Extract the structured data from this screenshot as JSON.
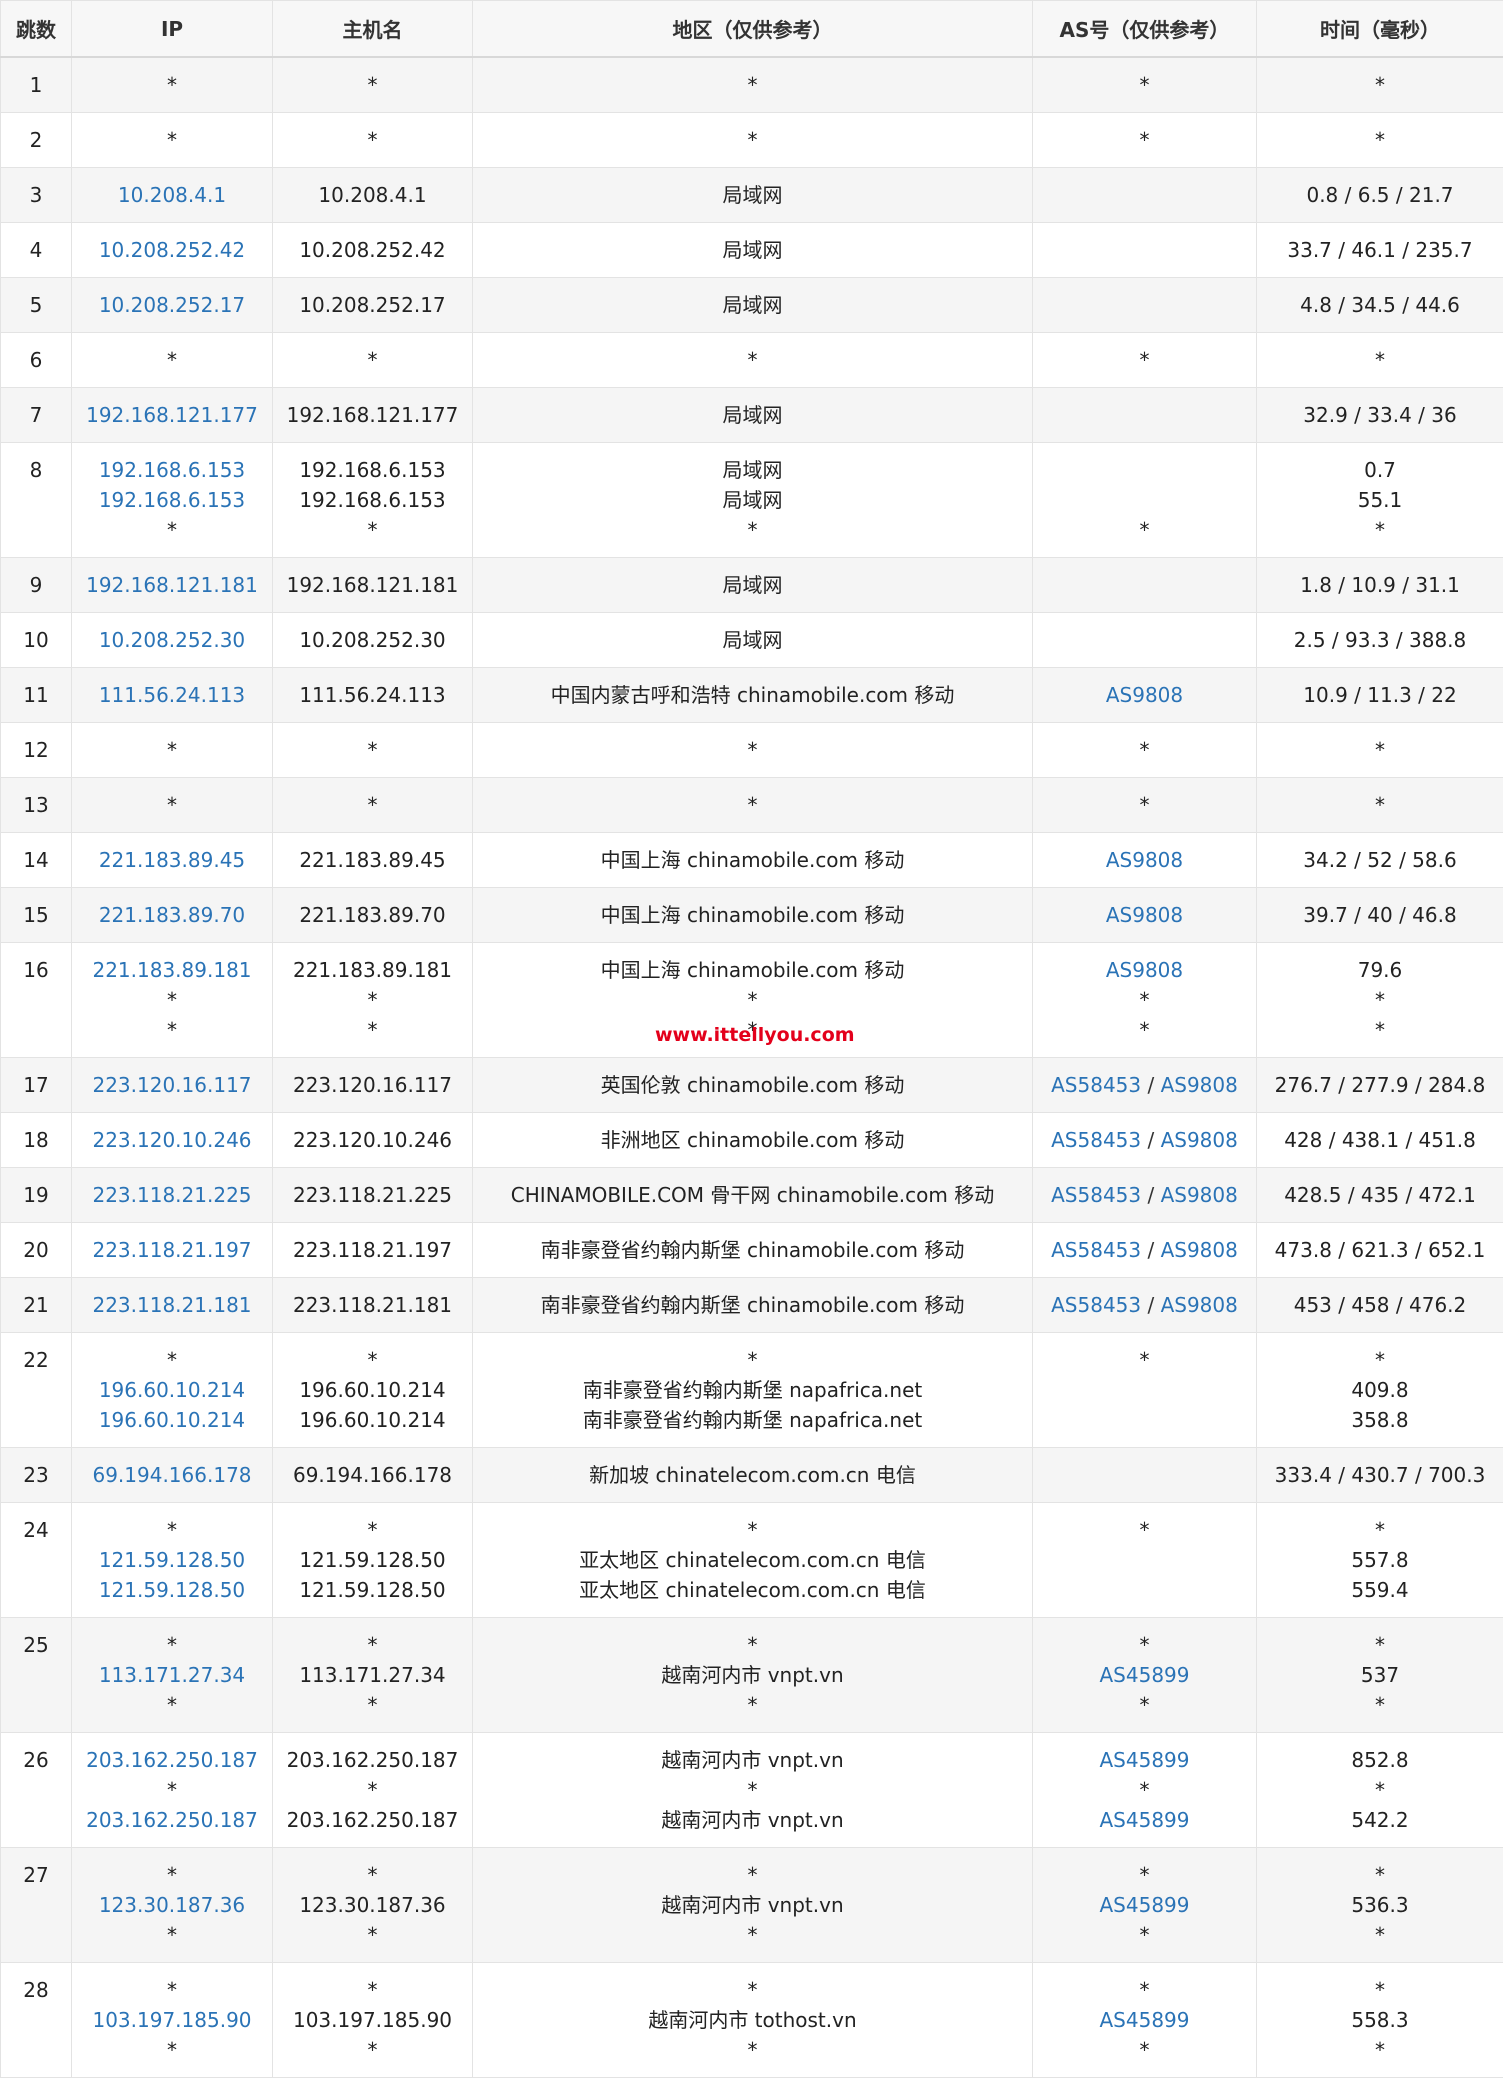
{
  "headers": {
    "hop": "跳数",
    "ip": "IP",
    "host": "主机名",
    "location": "地区（仅供参考）",
    "as": "AS号（仅供参考）",
    "time": "时间（毫秒）"
  },
  "rows": [
    {
      "hop": "1",
      "h": 55,
      "ip": [
        "*"
      ],
      "host": [
        "*"
      ],
      "loc": [
        "*"
      ],
      "as": [
        [
          "*"
        ]
      ],
      "time": [
        "*"
      ]
    },
    {
      "hop": "2",
      "h": 55,
      "ip": [
        "*"
      ],
      "host": [
        "*"
      ],
      "loc": [
        "*"
      ],
      "as": [
        [
          "*"
        ]
      ],
      "time": [
        "*"
      ]
    },
    {
      "hop": "3",
      "h": 55,
      "ip": [
        "10.208.4.1"
      ],
      "host": [
        "10.208.4.1"
      ],
      "loc": [
        "局域网"
      ],
      "as": [],
      "time": [
        "0.8 / 6.5 / 21.7"
      ]
    },
    {
      "hop": "4",
      "h": 55,
      "ip": [
        "10.208.252.42"
      ],
      "host": [
        "10.208.252.42"
      ],
      "loc": [
        "局域网"
      ],
      "as": [],
      "time": [
        "33.7 / 46.1 / 235.7"
      ]
    },
    {
      "hop": "5",
      "h": 55,
      "ip": [
        "10.208.252.17"
      ],
      "host": [
        "10.208.252.17"
      ],
      "loc": [
        "局域网"
      ],
      "as": [],
      "time": [
        "4.8 / 34.5 / 44.6"
      ]
    },
    {
      "hop": "6",
      "h": 55,
      "ip": [
        "*"
      ],
      "host": [
        "*"
      ],
      "loc": [
        "*"
      ],
      "as": [
        [
          "*"
        ]
      ],
      "time": [
        "*"
      ]
    },
    {
      "hop": "7",
      "h": 55,
      "ip": [
        "192.168.121.177"
      ],
      "host": [
        "192.168.121.177"
      ],
      "loc": [
        "局域网"
      ],
      "as": [],
      "time": [
        "32.9 / 33.4 / 36"
      ]
    },
    {
      "hop": "8",
      "h": 115,
      "ip": [
        "192.168.6.153",
        "192.168.6.153",
        "*"
      ],
      "host": [
        "192.168.6.153",
        "192.168.6.153",
        "*"
      ],
      "loc": [
        "局域网",
        "局域网",
        "*"
      ],
      "as": [
        [
          ""
        ],
        [
          ""
        ],
        [
          "*"
        ]
      ],
      "time": [
        "0.7",
        "55.1",
        "*"
      ]
    },
    {
      "hop": "9",
      "h": 55,
      "ip": [
        "192.168.121.181"
      ],
      "host": [
        "192.168.121.181"
      ],
      "loc": [
        "局域网"
      ],
      "as": [],
      "time": [
        "1.8 / 10.9 / 31.1"
      ]
    },
    {
      "hop": "10",
      "h": 55,
      "ip": [
        "10.208.252.30"
      ],
      "host": [
        "10.208.252.30"
      ],
      "loc": [
        "局域网"
      ],
      "as": [],
      "time": [
        "2.5 / 93.3 / 388.8"
      ]
    },
    {
      "hop": "11",
      "h": 55,
      "ip": [
        "111.56.24.113"
      ],
      "host": [
        "111.56.24.113"
      ],
      "loc": [
        "中国内蒙古呼和浩特 chinamobile.com 移动"
      ],
      "as": [
        [
          "AS9808"
        ]
      ],
      "time": [
        "10.9 / 11.3 / 22"
      ]
    },
    {
      "hop": "12",
      "h": 55,
      "ip": [
        "*"
      ],
      "host": [
        "*"
      ],
      "loc": [
        "*"
      ],
      "as": [
        [
          "*"
        ]
      ],
      "time": [
        "*"
      ]
    },
    {
      "hop": "13",
      "h": 55,
      "ip": [
        "*"
      ],
      "host": [
        "*"
      ],
      "loc": [
        "*"
      ],
      "as": [
        [
          "*"
        ]
      ],
      "time": [
        "*"
      ]
    },
    {
      "hop": "14",
      "h": 55,
      "ip": [
        "221.183.89.45"
      ],
      "host": [
        "221.183.89.45"
      ],
      "loc": [
        "中国上海 chinamobile.com 移动"
      ],
      "as": [
        [
          "AS9808"
        ]
      ],
      "time": [
        "34.2 / 52 / 58.6"
      ]
    },
    {
      "hop": "15",
      "h": 55,
      "ip": [
        "221.183.89.70"
      ],
      "host": [
        "221.183.89.70"
      ],
      "loc": [
        "中国上海 chinamobile.com 移动"
      ],
      "as": [
        [
          "AS9808"
        ]
      ],
      "time": [
        "39.7 / 40 / 46.8"
      ]
    },
    {
      "hop": "16",
      "h": 115,
      "ip": [
        "221.183.89.181",
        "*",
        "*"
      ],
      "host": [
        "221.183.89.181",
        "*",
        "*"
      ],
      "loc": [
        "中国上海 chinamobile.com 移动",
        "*",
        "*"
      ],
      "as": [
        [
          "AS9808"
        ],
        [
          "*"
        ],
        [
          "*"
        ]
      ],
      "time": [
        "79.6",
        "*",
        "*"
      ]
    },
    {
      "hop": "17",
      "h": 55,
      "ip": [
        "223.120.16.117"
      ],
      "host": [
        "223.120.16.117"
      ],
      "loc": [
        "英国伦敦 chinamobile.com 移动"
      ],
      "as": [
        [
          "AS58453",
          "AS9808"
        ]
      ],
      "time": [
        "276.7 / 277.9 / 284.8"
      ]
    },
    {
      "hop": "18",
      "h": 55,
      "ip": [
        "223.120.10.246"
      ],
      "host": [
        "223.120.10.246"
      ],
      "loc": [
        "非洲地区 chinamobile.com 移动"
      ],
      "as": [
        [
          "AS58453",
          "AS9808"
        ]
      ],
      "time": [
        "428 / 438.1 / 451.8"
      ]
    },
    {
      "hop": "19",
      "h": 55,
      "ip": [
        "223.118.21.225"
      ],
      "host": [
        "223.118.21.225"
      ],
      "loc": [
        "CHINAMOBILE.COM 骨干网 chinamobile.com 移动"
      ],
      "as": [
        [
          "AS58453",
          "AS9808"
        ]
      ],
      "time": [
        "428.5 / 435 / 472.1"
      ]
    },
    {
      "hop": "20",
      "h": 55,
      "ip": [
        "223.118.21.197"
      ],
      "host": [
        "223.118.21.197"
      ],
      "loc": [
        "南非豪登省约翰内斯堡 chinamobile.com 移动"
      ],
      "as": [
        [
          "AS58453",
          "AS9808"
        ]
      ],
      "time": [
        "473.8 / 621.3 / 652.1"
      ]
    },
    {
      "hop": "21",
      "h": 55,
      "ip": [
        "223.118.21.181"
      ],
      "host": [
        "223.118.21.181"
      ],
      "loc": [
        "南非豪登省约翰内斯堡 chinamobile.com 移动"
      ],
      "as": [
        [
          "AS58453",
          "AS9808"
        ]
      ],
      "time": [
        "453 / 458 / 476.2"
      ]
    },
    {
      "hop": "22",
      "h": 115,
      "ip": [
        "*",
        "196.60.10.214",
        "196.60.10.214"
      ],
      "host": [
        "*",
        "196.60.10.214",
        "196.60.10.214"
      ],
      "loc": [
        "*",
        "南非豪登省约翰内斯堡 napafrica.net",
        "南非豪登省约翰内斯堡 napafrica.net"
      ],
      "as": [
        [
          "*"
        ]
      ],
      "time": [
        "*",
        "409.8",
        "358.8"
      ]
    },
    {
      "hop": "23",
      "h": 55,
      "ip": [
        "69.194.166.178"
      ],
      "host": [
        "69.194.166.178"
      ],
      "loc": [
        "新加坡 chinatelecom.com.cn 电信"
      ],
      "as": [],
      "time": [
        "333.4 / 430.7 / 700.3"
      ]
    },
    {
      "hop": "24",
      "h": 115,
      "ip": [
        "*",
        "121.59.128.50",
        "121.59.128.50"
      ],
      "host": [
        "*",
        "121.59.128.50",
        "121.59.128.50"
      ],
      "loc": [
        "*",
        "亚太地区 chinatelecom.com.cn 电信",
        "亚太地区 chinatelecom.com.cn 电信"
      ],
      "as": [
        [
          "*"
        ]
      ],
      "time": [
        "*",
        "557.8",
        "559.4"
      ]
    },
    {
      "hop": "25",
      "h": 115,
      "ip": [
        "*",
        "113.171.27.34",
        "*"
      ],
      "host": [
        "*",
        "113.171.27.34",
        "*"
      ],
      "loc": [
        "*",
        "越南河内市 vnpt.vn",
        "*"
      ],
      "as": [
        [
          "*"
        ],
        [
          "AS45899"
        ],
        [
          "*"
        ]
      ],
      "time": [
        "*",
        "537",
        "*"
      ]
    },
    {
      "hop": "26",
      "h": 115,
      "ip": [
        "203.162.250.187",
        "*",
        "203.162.250.187"
      ],
      "host": [
        "203.162.250.187",
        "*",
        "203.162.250.187"
      ],
      "loc": [
        "越南河内市 vnpt.vn",
        "*",
        "越南河内市 vnpt.vn"
      ],
      "as": [
        [
          "AS45899"
        ],
        [
          "*"
        ],
        [
          "AS45899"
        ]
      ],
      "time": [
        "852.8",
        "*",
        "542.2"
      ]
    },
    {
      "hop": "27",
      "h": 115,
      "ip": [
        "*",
        "123.30.187.36",
        "*"
      ],
      "host": [
        "*",
        "123.30.187.36",
        "*"
      ],
      "loc": [
        "*",
        "越南河内市 vnpt.vn",
        "*"
      ],
      "as": [
        [
          "*"
        ],
        [
          "AS45899"
        ],
        [
          "*"
        ]
      ],
      "time": [
        "*",
        "536.3",
        "*"
      ]
    },
    {
      "hop": "28",
      "h": 115,
      "ip": [
        "*",
        "103.197.185.90",
        "*"
      ],
      "host": [
        "*",
        "103.197.185.90",
        "*"
      ],
      "loc": [
        "*",
        "越南河内市 tothost.vn",
        "*"
      ],
      "as": [
        [
          "*"
        ],
        [
          "AS45899"
        ],
        [
          "*"
        ]
      ],
      "time": [
        "*",
        "558.3",
        "*"
      ]
    }
  ],
  "watermark": "www.ittellyou.com",
  "colors": {
    "link": "#2a73b6",
    "stripe": "#f5f5f5",
    "watermark": "#e3001b"
  }
}
